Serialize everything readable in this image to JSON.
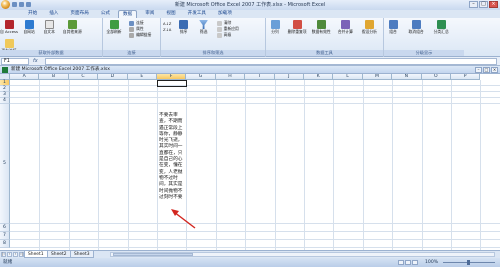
{
  "window": {
    "title": "新建 Microsoft Office Excel 2007 工作表.xlsx - Microsoft Excel"
  },
  "ribbon_tabs": [
    {
      "label": "开始",
      "active": false
    },
    {
      "label": "插入",
      "active": false
    },
    {
      "label": "页面布局",
      "active": false
    },
    {
      "label": "公式",
      "active": false
    },
    {
      "label": "数据",
      "active": true
    },
    {
      "label": "审阅",
      "active": false
    },
    {
      "label": "视图",
      "active": false
    },
    {
      "label": "开发工具",
      "active": false
    },
    {
      "label": "加载项",
      "active": false
    }
  ],
  "ribbon": {
    "groups": {
      "external": "获取外部数据",
      "connections": "连接",
      "sort_filter": "排序和筛选",
      "tools": "数据工具",
      "outline": "分级显示"
    },
    "buttons": {
      "from_access": "自 Access",
      "from_web": "自网站",
      "from_text": "自文本",
      "from_other": "自其他来源",
      "existing": "现有连接",
      "refresh_all": "全部刷新",
      "connections": "连接",
      "properties": "属性",
      "edit_links": "编辑链接",
      "sort_az": "A↓Z",
      "sort_za": "Z↓A",
      "sort": "排序",
      "filter": "筛选",
      "clear": "清除",
      "reapply": "重新应用",
      "advanced": "高级",
      "text_to_columns": "分列",
      "remove_duplicates": "删除重复项",
      "data_validation": "数据有效性",
      "consolidate": "合并计算",
      "what_if": "假设分析",
      "group": "组合",
      "ungroup": "取消组合",
      "subtotal": "分类汇总"
    }
  },
  "formula_bar": {
    "name_box": "F1",
    "fx": "fx",
    "formula": ""
  },
  "workbook": {
    "title": "新建 Microsoft Office Excel 2007 工作表.xlsx"
  },
  "grid": {
    "columns": [
      "A",
      "B",
      "C",
      "D",
      "E",
      "F",
      "G",
      "H",
      "I",
      "J",
      "K",
      "L",
      "M",
      "N",
      "O",
      "P"
    ],
    "selected_column": "F",
    "rows": [
      "1",
      "2",
      "3",
      "4",
      "5",
      "6",
      "7",
      "8"
    ],
    "selected_row": "1",
    "cell_f4_text": "不要去审查，不期而遇正常段上等你，静静时光飞逝，其实时间一直都在，只是自己的心在变，懂在变，人老抛物不过时间，其实是时间抛物不过刻时不要"
  },
  "sheets": [
    {
      "label": "Sheet1",
      "active": true
    },
    {
      "label": "Sheet2",
      "active": false
    },
    {
      "label": "Sheet3",
      "active": false
    }
  ],
  "status": {
    "ready": "就绪",
    "zoom": "100%"
  },
  "colors": {
    "accent": "#15428b",
    "annotation_arrow": "#d3261f"
  }
}
